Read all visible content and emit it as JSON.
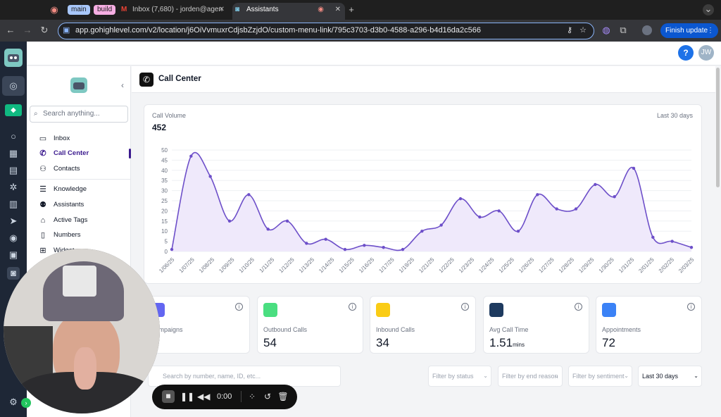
{
  "browser": {
    "tabs": [
      {
        "label": "main"
      },
      {
        "label": "build"
      },
      {
        "label": "Inbox (7,680) - jorden@agen"
      },
      {
        "label": "Assistants"
      }
    ],
    "url": "app.gohighlevel.com/v2/location/j6OiVvmuxrCdjsbZzjdO/custom-menu-link/795c3703-d3b0-4588-a296-b4d16da2c566",
    "finish_update": "Finish update"
  },
  "header": {
    "help": "?",
    "avatar": "JW"
  },
  "sidemenu": {
    "search_placeholder": "Search anything...",
    "items": [
      {
        "label": "Inbox",
        "icon": "inbox-icon"
      },
      {
        "label": "Call Center",
        "icon": "phone-icon"
      },
      {
        "label": "Contacts",
        "icon": "contacts-icon"
      },
      {
        "label": "Knowledge",
        "icon": "database-icon"
      },
      {
        "label": "Assistants",
        "icon": "user-plus-icon"
      },
      {
        "label": "Active Tags",
        "icon": "tag-icon"
      },
      {
        "label": "Numbers",
        "icon": "smartphone-icon"
      },
      {
        "label": "Widget",
        "icon": "widget-icon"
      }
    ]
  },
  "page": {
    "title": "Call Center"
  },
  "chart_card": {
    "label": "Call Volume",
    "total": "452",
    "range": "Last 30 days"
  },
  "chart_data": {
    "type": "area",
    "x": [
      "1/06/25",
      "1/07/25",
      "1/08/25",
      "1/09/25",
      "1/10/25",
      "1/11/25",
      "1/12/25",
      "1/13/25",
      "1/14/25",
      "1/15/25",
      "1/16/25",
      "1/17/25",
      "1/19/25",
      "1/21/25",
      "1/22/25",
      "1/23/25",
      "1/24/25",
      "1/25/25",
      "1/26/25",
      "1/27/25",
      "1/28/25",
      "1/29/25",
      "1/30/25",
      "1/31/25",
      "2/01/25",
      "2/02/25",
      "2/03/25"
    ],
    "values": [
      1,
      47,
      37,
      15,
      28,
      11,
      15,
      4,
      6,
      1,
      3,
      2,
      1,
      10,
      13,
      26,
      17,
      20,
      10,
      28,
      21,
      21,
      33,
      27,
      41,
      7,
      5,
      2
    ],
    "ylim": [
      0,
      50
    ],
    "yticks": [
      0,
      5,
      10,
      15,
      20,
      25,
      30,
      35,
      40,
      45,
      50
    ],
    "color": "#6d4fc9",
    "fill": "#efe9fb",
    "grid": true
  },
  "stats": [
    {
      "label": "Campaigns",
      "value": "",
      "icon": "megaphone-icon",
      "color": "#6366f1"
    },
    {
      "label": "Outbound Calls",
      "value": "54",
      "icon": "phone-outgoing-icon",
      "color": "#4ade80"
    },
    {
      "label": "Inbound Calls",
      "value": "34",
      "icon": "phone-incoming-icon",
      "color": "#facc15"
    },
    {
      "label": "Avg Call Time",
      "value": "1.51",
      "unit": "mins",
      "icon": "clock-icon",
      "color": "#1e3a5f"
    },
    {
      "label": "Appointments",
      "value": "72",
      "icon": "calendar-icon",
      "color": "#3b82f6"
    }
  ],
  "filters": {
    "search_placeholder": "Search by number, name, ID, etc...",
    "status": "Filter by status",
    "end_reason": "Filter by end reason",
    "sentiment": "Filter by sentiment",
    "period": "Last 30 days"
  },
  "recorder": {
    "timer": "0:00"
  }
}
